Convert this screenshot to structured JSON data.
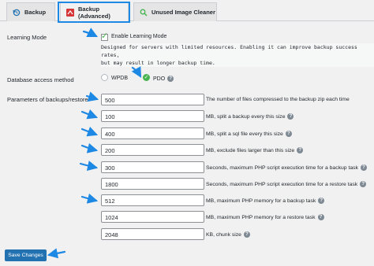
{
  "tabs": [
    {
      "label": "Backup",
      "icon": "backup-restore-icon"
    },
    {
      "label": "Backup (Advanced)",
      "icon": "red-advanced-icon"
    },
    {
      "label": "Unused Image Cleaner",
      "icon": "magnifier-icon"
    }
  ],
  "learning_mode": {
    "label": "Learning Mode",
    "checkbox_label": "Enable Learning Mode",
    "checked": true,
    "note_line1": "Designed for servers with limited resources. Enabling it can improve backup success rates,",
    "note_line2": "but may result in longer backup time."
  },
  "db_access": {
    "label": "Database access method",
    "options": [
      "WPDB",
      "PDO"
    ],
    "selected": "PDO"
  },
  "params": {
    "label": "Parameters of backups/restore",
    "fields": [
      {
        "value": "500",
        "desc": "The number of files compressed to the backup zip each time",
        "help": false
      },
      {
        "value": "100",
        "desc": "MB, split a backup every this size",
        "help": true
      },
      {
        "value": "400",
        "desc": "MB, split a sql file every this size",
        "help": true
      },
      {
        "value": "200",
        "desc": "MB, exclude files larger than this size",
        "help": true
      },
      {
        "value": "300",
        "desc": "Seconds, maximum PHP script execution time for a backup task",
        "help": true
      },
      {
        "value": "1800",
        "desc": "Seconds, maximum PHP script execution time for a restore task",
        "help": true
      },
      {
        "value": "512",
        "desc": "MB, maximum PHP memory for a backup task",
        "help": true
      },
      {
        "value": "1024",
        "desc": "MB, maximum PHP memory for a restore task",
        "help": true
      },
      {
        "value": "2048",
        "desc": "KB, chunk size",
        "help": true
      }
    ]
  },
  "save_button": "Save Changes",
  "help_glyph": "?",
  "colors": {
    "accent": "#2271b1",
    "highlight": "#1e88e5",
    "check": "#46b450"
  }
}
